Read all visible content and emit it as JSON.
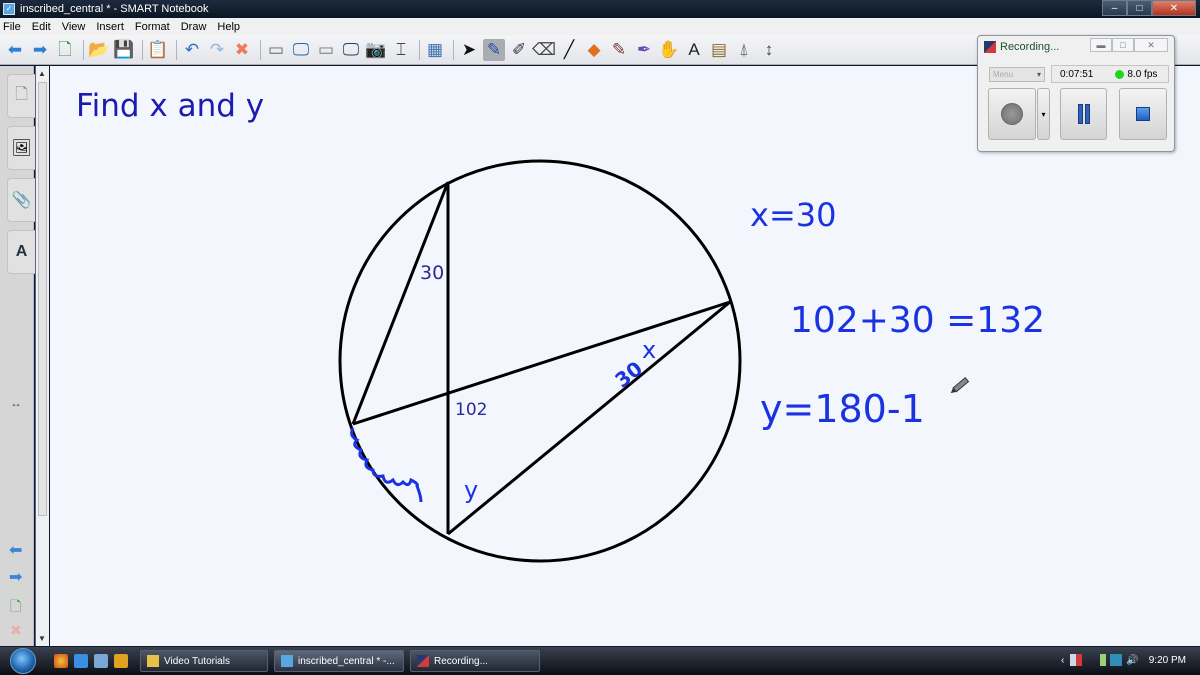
{
  "window": {
    "title": "inscribed_central * - SMART Notebook",
    "controls": {
      "minimize": "–",
      "maximize": "□",
      "close": "✕"
    }
  },
  "menu": [
    "File",
    "Edit",
    "View",
    "Insert",
    "Format",
    "Draw",
    "Help"
  ],
  "toolbar": {
    "items": [
      {
        "name": "back-icon",
        "glyph": "⬅",
        "color": "#2f7fd0"
      },
      {
        "name": "forward-icon",
        "glyph": "➡",
        "color": "#2f7fd0"
      },
      {
        "name": "add-page-icon",
        "glyph": "🗋",
        "color": "#2a9a3a"
      },
      {
        "name": "open-folder-icon",
        "glyph": "📂",
        "color": "#e0a82b"
      },
      {
        "name": "save-icon",
        "glyph": "💾",
        "color": "#2b5fb0"
      },
      {
        "name": "paste-icon",
        "glyph": "📋",
        "color": "#8b6a3c"
      },
      {
        "name": "undo-icon",
        "glyph": "↶",
        "color": "#2b6fc8"
      },
      {
        "name": "redo-icon",
        "glyph": "↷",
        "color": "#8fb5dc"
      },
      {
        "name": "delete-icon",
        "glyph": "✖",
        "color": "#f07a5a"
      },
      {
        "name": "screen-shade-icon",
        "glyph": "▭",
        "color": "#666"
      },
      {
        "name": "full-screen-icon",
        "glyph": "🖵",
        "color": "#1e63b0"
      },
      {
        "name": "transparent-background-icon",
        "glyph": "▭",
        "color": "#777"
      },
      {
        "name": "dual-page-icon",
        "glyph": "🖵",
        "color": "#1e3e70"
      },
      {
        "name": "capture-icon",
        "glyph": "📷",
        "color": "#555"
      },
      {
        "name": "document-camera-icon",
        "glyph": "⌶",
        "color": "#444"
      },
      {
        "name": "table-icon",
        "glyph": "▦",
        "color": "#3a6fb0"
      },
      {
        "name": "select-icon",
        "glyph": "➤",
        "color": "#111"
      },
      {
        "name": "pen-icon",
        "glyph": "✎",
        "color": "#2a4fa8",
        "active": true
      },
      {
        "name": "creative-pen-icon",
        "glyph": "✐",
        "color": "#334"
      },
      {
        "name": "eraser-icon",
        "glyph": "⌫",
        "color": "#444"
      },
      {
        "name": "line-icon",
        "glyph": "╱",
        "color": "#111"
      },
      {
        "name": "shapes-icon",
        "glyph": "◆",
        "color": "#e07020"
      },
      {
        "name": "fill-icon",
        "glyph": "✎",
        "color": "#7a3a3a"
      },
      {
        "name": "magic-pen-icon",
        "glyph": "✒",
        "color": "#6a4ab0"
      },
      {
        "name": "shape-recognition-icon",
        "glyph": "✋",
        "color": "#2a5a8a"
      },
      {
        "name": "text-icon",
        "glyph": "A",
        "color": "#222"
      },
      {
        "name": "properties-icon",
        "glyph": "▤",
        "color": "#8a6a2a"
      },
      {
        "name": "measurement-tools-icon",
        "glyph": "⍋",
        "color": "#777"
      },
      {
        "name": "toolbar-move-icon",
        "glyph": "↕",
        "color": "#444"
      }
    ]
  },
  "sidebar": {
    "tabs": [
      {
        "name": "page-sorter-tab",
        "glyph": "🗋"
      },
      {
        "name": "gallery-tab",
        "glyph": "🖼"
      },
      {
        "name": "attachments-tab",
        "glyph": "📎"
      },
      {
        "name": "properties-tab",
        "glyph": "A"
      }
    ],
    "resize_glyph": "↔",
    "bottom_icons": [
      {
        "name": "back-icon",
        "glyph": "⬅"
      },
      {
        "name": "forward-icon",
        "glyph": "➡"
      },
      {
        "name": "add-page-icon",
        "glyph": "🗋"
      },
      {
        "name": "delete-page-icon",
        "glyph": "✖"
      }
    ]
  },
  "page": {
    "title": "Find x and y",
    "diagram": {
      "labels": {
        "angle_top": "30",
        "angle_center": "102",
        "angle_y": "y",
        "angle_x": "x",
        "angle_x_value": "30"
      }
    },
    "handwriting": [
      "x=30",
      "102+30 =132",
      "y=180-1"
    ]
  },
  "recorder": {
    "title": "Recording...",
    "menu_label": "Menu",
    "elapsed": "0:07:51",
    "fps": "8.0 fps",
    "status_color": "#22d322",
    "buttons": {
      "record": "record",
      "pause": "pause",
      "stop": "stop"
    }
  },
  "taskbar": {
    "tasks": [
      "Video Tutorials",
      "inscribed_central * -...",
      "Recording..."
    ],
    "clock": "9:20 PM",
    "tray_chevron": "‹",
    "volume_glyph": "🔊"
  }
}
